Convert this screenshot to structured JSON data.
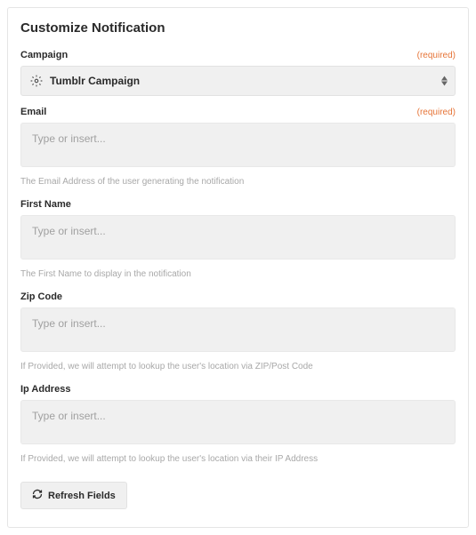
{
  "title": "Customize Notification",
  "requiredText": "(required)",
  "placeholder": "Type or insert...",
  "campaign": {
    "label": "Campaign",
    "value": "Tumblr Campaign"
  },
  "email": {
    "label": "Email",
    "help": "The Email Address of the user generating the notification"
  },
  "firstName": {
    "label": "First Name",
    "help": "The First Name to display in the notification"
  },
  "zipCode": {
    "label": "Zip Code",
    "help": "If Provided, we will attempt to lookup the user's location via ZIP/Post Code"
  },
  "ipAddress": {
    "label": "Ip Address",
    "help": "If Provided, we will attempt to lookup the user's location via their IP Address"
  },
  "refreshButton": "Refresh Fields"
}
